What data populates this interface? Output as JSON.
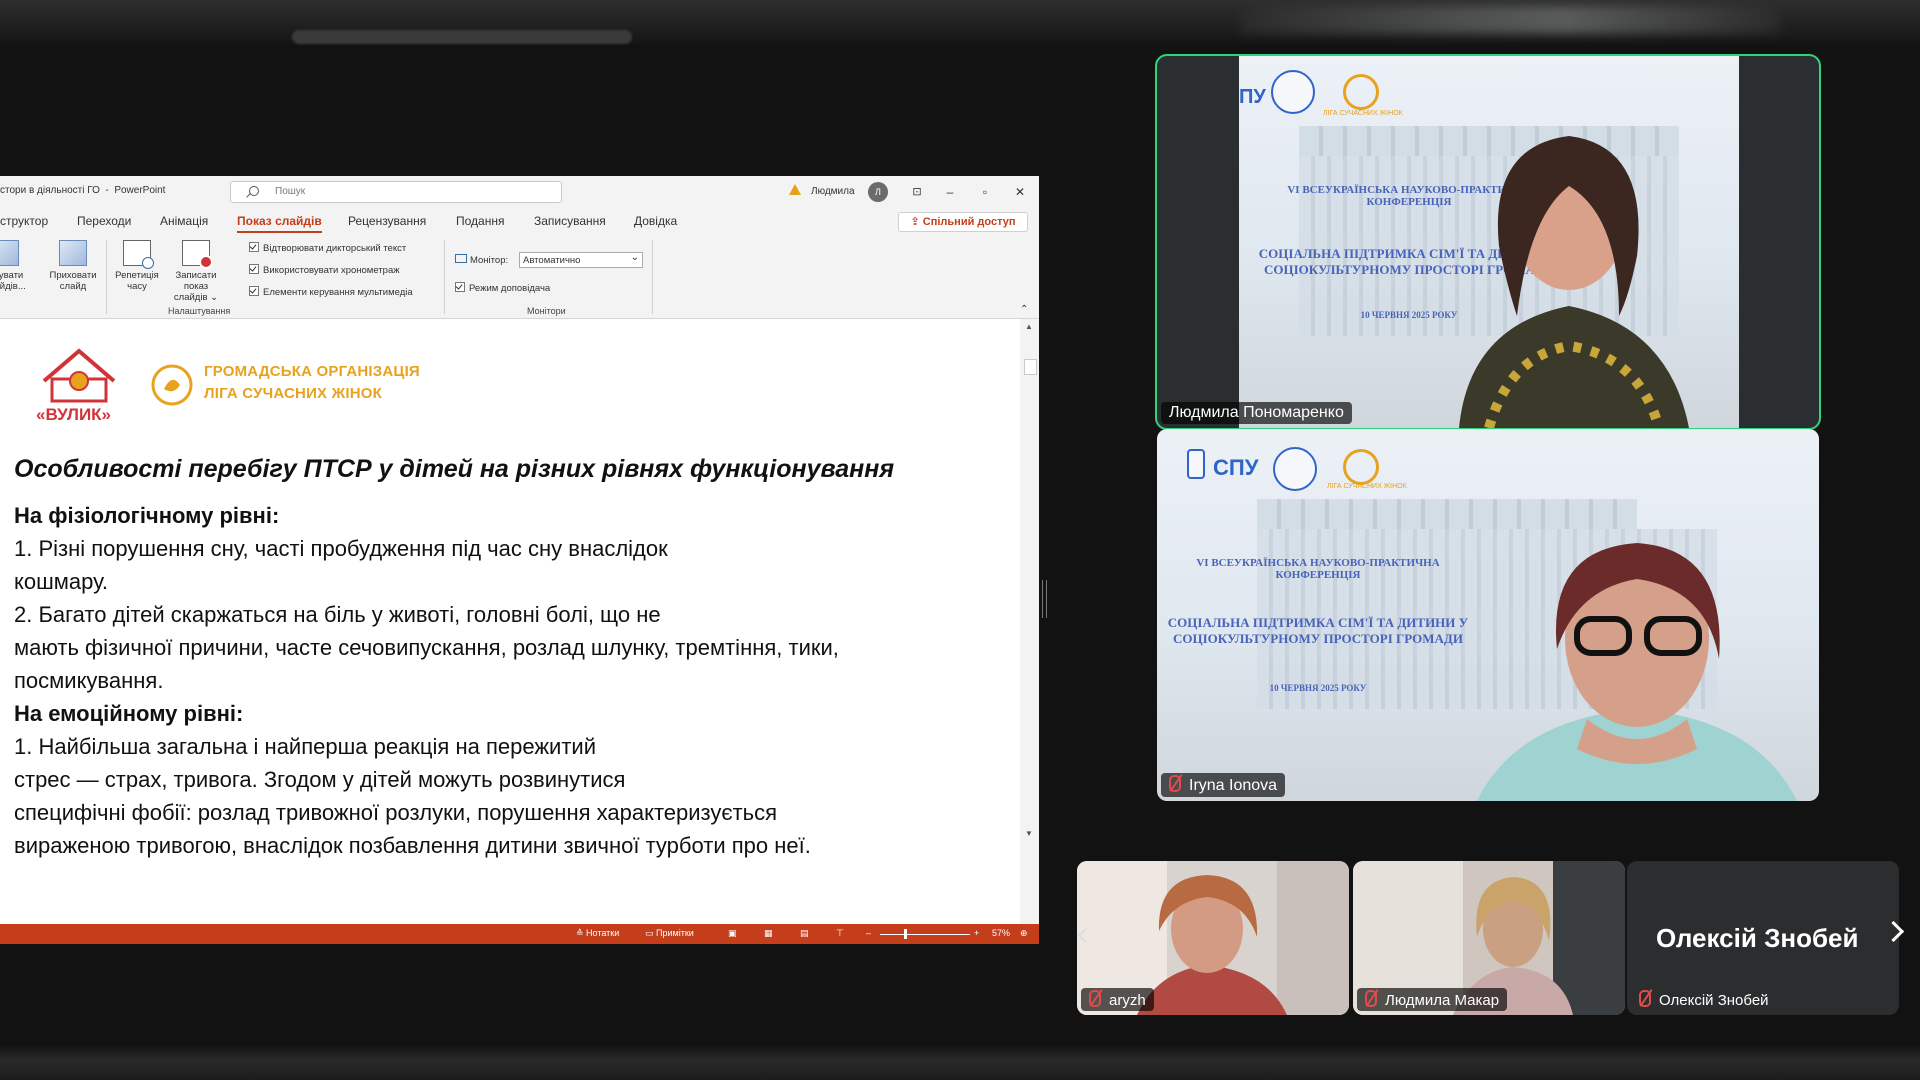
{
  "ppt": {
    "doc_title": "стори в діяльності ГО",
    "app_name": "PowerPoint",
    "search_placeholder": "Пошук",
    "user_name": "Людмила",
    "avatar_letter": "Л",
    "window_buttons": [
      "–",
      "▫",
      "✕"
    ],
    "tabs": [
      {
        "label": "структор"
      },
      {
        "label": "Переходи"
      },
      {
        "label": "Анімація"
      },
      {
        "label": "Показ слайдів",
        "active": true
      },
      {
        "label": "Рецензування"
      },
      {
        "label": "Подання"
      },
      {
        "label": "Записування"
      },
      {
        "label": "Довідка"
      }
    ],
    "share_label": "Спільний доступ",
    "ribbon": {
      "btn_custom": "штувати слайдів...",
      "btn_hide": "Приховати слайд",
      "btn_rehearse": "Репетиція часу",
      "btn_record": "Записати показ слайдів ⌄",
      "chk_narration": "Відтворювати дикторський текст",
      "chk_timings": "Використовувати хронометраж",
      "chk_media": "Елементи керування мультимедіа",
      "group_setup": "Налаштування",
      "monitor_label": "Монітор:",
      "monitor_value": "Автоматично",
      "chk_presenter": "Режим доповідача",
      "group_monitors": "Монітори"
    },
    "statusbar": {
      "notes": "Нотатки",
      "comments": "Примітки",
      "zoom": "57%"
    }
  },
  "slide": {
    "logo_text": "«ВУЛИК»",
    "org_line1": "ГРОМАДСЬКА ОРГАНІЗАЦІЯ",
    "org_line2": "ЛІГА СУЧАСНИХ ЖІНОК",
    "title": "Особливості перебігу ПТСР у дітей на різних рівнях функціонування",
    "heading1": "На фізіологічному рівні:",
    "p1a": "1. Різні порушення сну, часті пробудження під час сну внаслідок",
    "p1b": "кошмару.",
    "p2a": "2. Багато дітей скаржаться на біль у животі, головні болі, що не",
    "p2b": "мають фізичної причини, часте сечовипускання, розлад шлунку, тремтіння, тики,",
    "p2c": "посмикування.",
    "heading2": "На емоційному рівні:",
    "p3a": "1. Найбільша загальна і найперша реакція на пережитий",
    "p3b": "стрес — страх, тривога. Згодом у дітей можуть розвинутися",
    "p3c": "специфічні фобії: розлад тривожної розлуки, порушення характеризується",
    "p3d": "вираженою тривогою, внаслідок позбавлення дитини звичної турботи про неї."
  },
  "poster": {
    "spu": "СПУ",
    "conf_line1": "VI ВСЕУКРАЇНСЬКА НАУКОВО-ПРАКТИЧНА",
    "conf_line2": "КОНФЕРЕНЦІЯ",
    "theme_line1": "СОЦІАЛЬНА ПІДТРИМКА СІМ'Ї ТА ДИТИНИ У",
    "theme_line2": "СОЦІОКУЛЬТУРНОМУ ПРОСТОРІ ГРОМАДИ",
    "date": "10 ЧЕРВНЯ 2025 РОКУ",
    "league": "ЛІГА СУЧАСНИХ ЖІНОК"
  },
  "participants": {
    "p1": "Людмила Пономаренко",
    "p2": "Iryna Ionova",
    "p3": "aryzh",
    "p4": "Людмила Макар",
    "p5": "Олексій Знобей",
    "p5_big": "Олексій Знобей"
  },
  "colors": {
    "ppt_accent": "#c43e1c",
    "speaking_outline": "#2ed47a",
    "org_yellow": "#e8a21e",
    "muted_red": "#e04b4b"
  }
}
